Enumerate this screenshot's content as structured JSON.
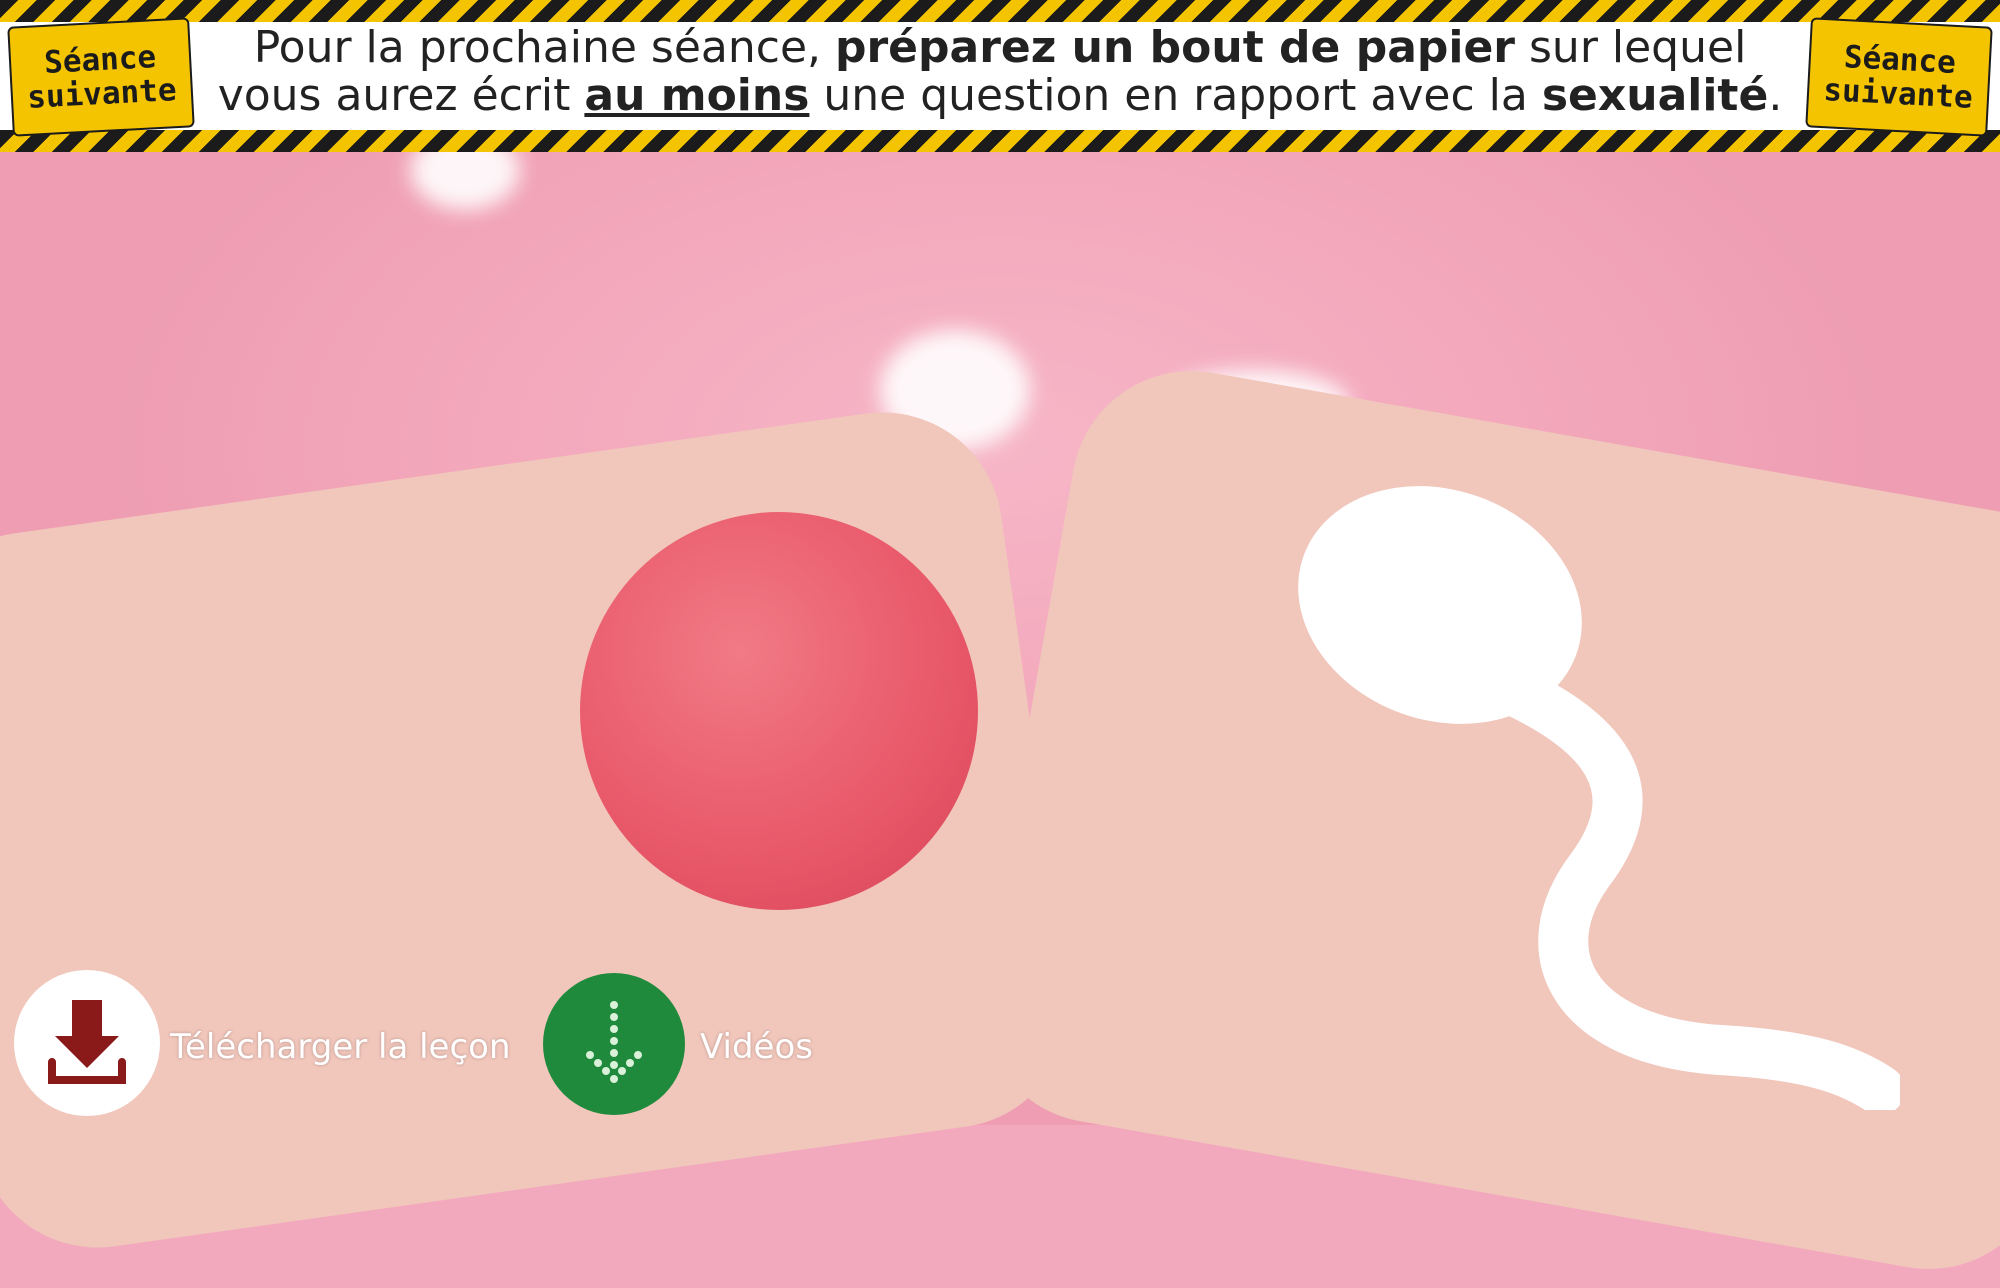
{
  "banner": {
    "sign_left_line1": "Séance",
    "sign_left_line2": "suivante",
    "sign_right_line1": "Séance",
    "sign_right_line2": "suivante",
    "line1_part1": "Pour la prochaine séance, ",
    "line1_bold": "préparez un bout de papier",
    "line1_part2": " sur lequel",
    "line2_part1": "vous aurez écrit ",
    "line2_underline": "au moins",
    "line2_part2": " une question en rapport avec la ",
    "line2_bold": "sexualité",
    "line2_end": "."
  },
  "actions": {
    "download_label": "Télécharger la leçon",
    "download_icon": "download-icon",
    "videos_label": "Vidéos",
    "videos_icon": "arrow-down-icon"
  },
  "colors": {
    "tape_yellow": "#f5c400",
    "tape_black": "#1b1b1b",
    "video_green": "#1f8a3b",
    "background_pink": "#f3a7bb"
  }
}
